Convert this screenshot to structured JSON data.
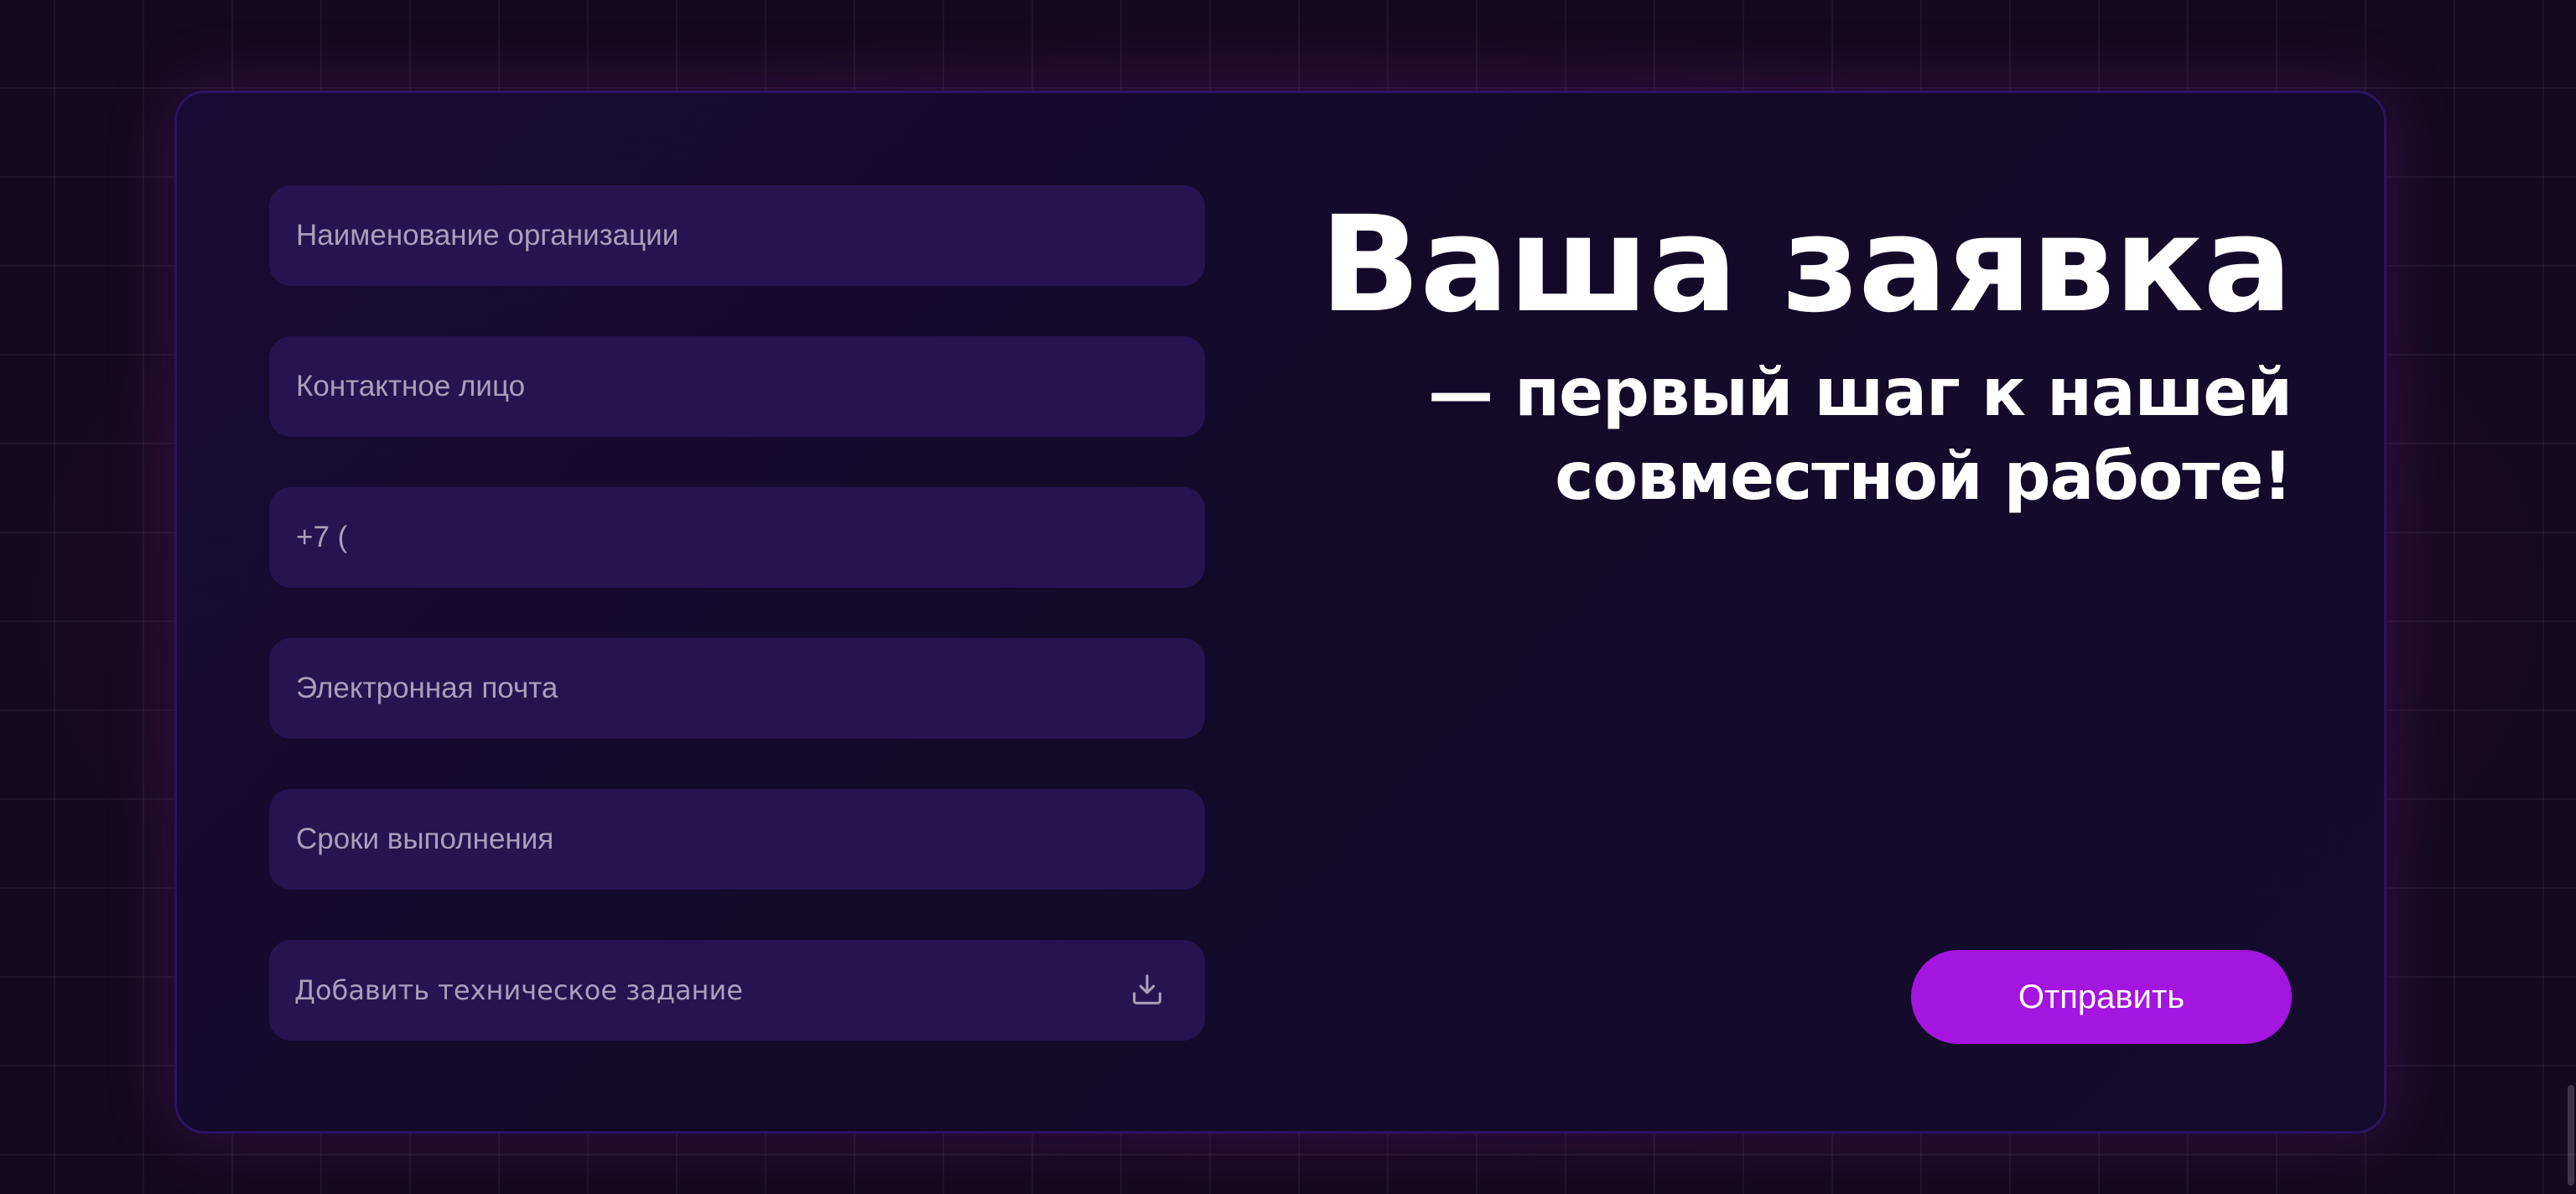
{
  "form": {
    "fields": [
      {
        "placeholder": "Наименование организации"
      },
      {
        "placeholder": "Контактное лицо"
      },
      {
        "placeholder": "+7 ("
      },
      {
        "placeholder": "Электронная почта"
      },
      {
        "placeholder": "Сроки выполнения"
      }
    ],
    "upload": {
      "label": "Добавить техническое задание",
      "icon": "download-icon"
    }
  },
  "heading": {
    "title": "Ваша заявка",
    "subtitle_line1": "— первый шаг к нашей",
    "subtitle_line2": "совместной работе!"
  },
  "submit": {
    "label": "Отправить"
  },
  "colors": {
    "background": "#140a20",
    "card": "#150b2c",
    "field": "#261450",
    "accent": "#a515e0",
    "text": "#ffffff",
    "placeholder": "#a99fba"
  }
}
